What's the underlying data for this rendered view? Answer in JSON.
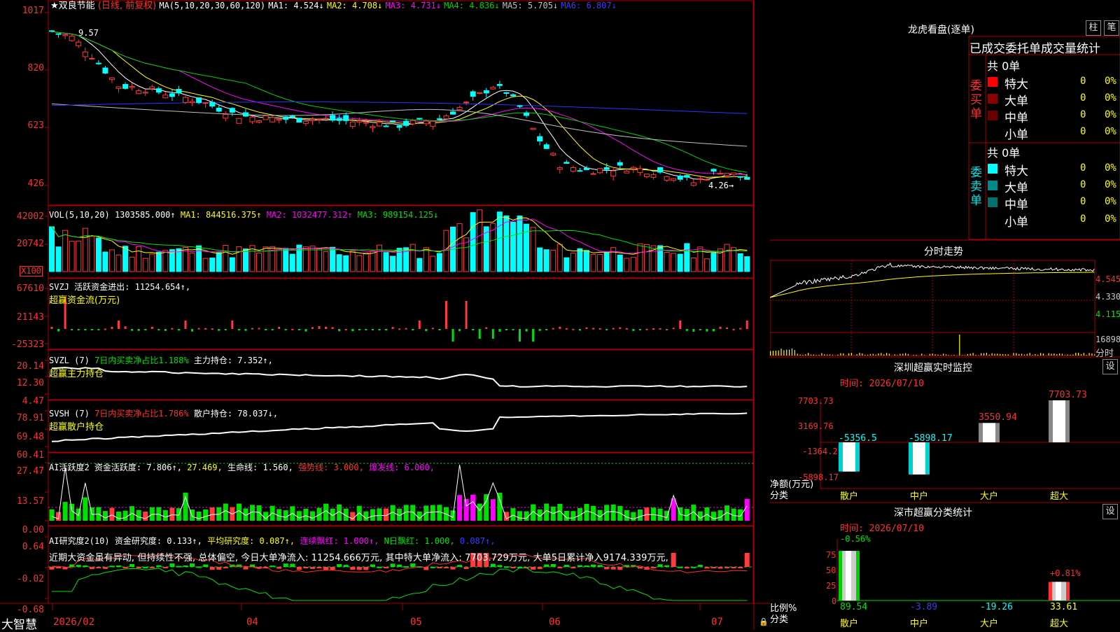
{
  "app": {
    "brand": "大智慧"
  },
  "colors": {
    "up": "#ff3b3b",
    "down": "#00ffff",
    "green": "#00e000",
    "ma1": "#ffffff",
    "ma2": "#ffff00",
    "ma3": "#ff00ff",
    "ma4": "#00d000",
    "ma5": "#c0c0c0",
    "ma6": "#3030ff",
    "grid": "#aa0000",
    "axis": "#ff3030"
  },
  "price": {
    "title": "★双良节能",
    "mode": "(日线, 前复权)",
    "ma_params": "MA(5,10,20,30,60,120)",
    "ma": [
      {
        "label": "MA1: 4.524↓"
      },
      {
        "label": "MA2: 4.708↓"
      },
      {
        "label": "MA3: 4.731↓"
      },
      {
        "label": "MA4: 4.836↓"
      },
      {
        "label": "MA5: 5.705↓"
      },
      {
        "label": "MA6: 6.807↓"
      }
    ],
    "yticks": [
      "1017",
      "820",
      "623",
      "426"
    ],
    "high_label": "9.57",
    "low_label": "4.26→"
  },
  "vol": {
    "title": "VOL(5,10,20)",
    "value": "1303585.000↑",
    "ma1": "MA1: 844516.375↑",
    "ma2": "MA2: 1032477.312↑",
    "ma3": "MA3: 989154.125↓",
    "yticks": [
      "42002",
      "20742"
    ],
    "unit": "X100"
  },
  "svzj": {
    "title": "SVZJ",
    "line": "活跃资金进出: 11254.654↑,",
    "sub": "超赢资金流(万元)",
    "yticks": [
      "67610",
      "21143",
      "-25323"
    ]
  },
  "svzl": {
    "title": "SVZL (7)",
    "l1": "7日内买卖净占比1.188%",
    "l2": "主力持仓: 7.352↑,",
    "sub": "超赢主力持仓",
    "yticks": [
      "20.14",
      "12.30",
      "4.47"
    ]
  },
  "svsh": {
    "title": "SVSH (7)",
    "l1": "7日内买卖净占比1.786%",
    "l2": "散户持仓: 78.037↓,",
    "sub": "超赢散户持仓",
    "yticks": [
      "78.91",
      "69.48",
      "60.41"
    ]
  },
  "ai1": {
    "title": "AI活跃度2",
    "l1": "资金活跃度: 7.806↑,",
    "l2": "27.469,",
    "l3": "生命线: 1.560,",
    "l4": "强势线: 3.000,",
    "l5": "爆发线: 6.000,",
    "yticks": [
      "27.47",
      "13.57",
      "0.00"
    ]
  },
  "ai2": {
    "title": "AI研究度2(10)",
    "l1": "资金研究度: 0.133↑,",
    "l2": "平均研究度: 0.087↑,",
    "l3": "连续飘红: 1.000↑,",
    "l4": "N日飘红: 1.000,",
    "l5": "0.087↑,",
    "desc": "近期大资金虽有异动, 但持续性不强, 总体偏空, 今日大单净流入: 11254.666万元, 其中特大单净流入: 7703.729万元, 大单5日累计净入9174.339万元,",
    "yticks": [
      "0.64",
      "-0.02",
      "-0.68"
    ]
  },
  "xaxis": {
    "labels": [
      "2026/02",
      "04",
      "05",
      "06",
      "07"
    ]
  },
  "right": {
    "lhb": {
      "title": "龙虎看盘(逐单)",
      "btn1": "柱",
      "btn2": "笔",
      "subtitle": "已成交委托单成交量统计",
      "buy": {
        "side": "委买单",
        "total": "共 0单",
        "rows": [
          {
            "name": "特大",
            "count": "0",
            "pct": "0%"
          },
          {
            "name": "大单",
            "count": "0",
            "pct": "0%"
          },
          {
            "name": "中单",
            "count": "0",
            "pct": "0%"
          },
          {
            "name": "小单",
            "count": "0",
            "pct": "0%"
          }
        ]
      },
      "sell": {
        "side": "委卖单",
        "total": "共 0单",
        "rows": [
          {
            "name": "特大",
            "count": "0",
            "pct": "0%"
          },
          {
            "name": "大单",
            "count": "0",
            "pct": "0%"
          },
          {
            "name": "中单",
            "count": "0",
            "pct": "0%"
          },
          {
            "name": "小单",
            "count": "0",
            "pct": "0%"
          }
        ]
      }
    },
    "intraday": {
      "title": "分时走势",
      "yticks": [
        "4.545",
        "4.330",
        "4.115"
      ],
      "vol_tick": "16898",
      "vol_label": "分时"
    },
    "monitor": {
      "title": "深圳超赢实时监控",
      "btn": "设",
      "date": "时间: 2026/07/10",
      "yticks": [
        "7703.73",
        "3169.76",
        "-1364.2",
        "-5898.17"
      ],
      "ylabel1": "净额(万元)",
      "ylabel2": "分类",
      "cats": [
        "散户",
        "中户",
        "大户",
        "超大"
      ],
      "values": [
        "-5356.5",
        "-5898.17",
        "3550.94",
        "7703.73"
      ]
    },
    "classify": {
      "title": "深市超赢分类统计",
      "btn": "设",
      "date": "时间: 2026/07/10",
      "yticks": [
        "75",
        "50",
        "25",
        "0"
      ],
      "ylabel1": "比例%",
      "ylabel2": "分类",
      "cats": [
        "散户",
        "中户",
        "大户",
        "超大"
      ],
      "values": [
        "89.54",
        "-3.89",
        "-19.26",
        "33.61"
      ],
      "top_labels": [
        "-0.56%",
        "+0.81%"
      ]
    }
  },
  "chart_data": [
    {
      "type": "candlestick",
      "title": "★双良节能",
      "ylim": [
        4.26,
        10.17
      ],
      "x_range": [
        "2026/02",
        "2026/07/10"
      ],
      "last_close": 4.52,
      "ma": {
        "MA1": 4.524,
        "MA2": 4.708,
        "MA3": 4.731,
        "MA4": 4.836,
        "MA5": 5.705,
        "MA6": 6.807
      },
      "high_marker": 9.57,
      "low_marker": 4.26
    },
    {
      "type": "bar",
      "title": "VOL(5,10,20)",
      "last": 1303585.0,
      "ylim": [
        0,
        42002
      ]
    },
    {
      "type": "bar",
      "title": "SVZJ",
      "last": 11254.654,
      "ylim": [
        -25323,
        67610
      ]
    },
    {
      "type": "line",
      "title": "SVZL (7)",
      "last": 7.352,
      "ylim": [
        4.47,
        20.14
      ]
    },
    {
      "type": "line",
      "title": "SVSH (7)",
      "last": 78.037,
      "ylim": [
        60.41,
        78.91
      ]
    },
    {
      "type": "bar",
      "title": "AI活跃度2",
      "last": 7.806,
      "ylim": [
        0,
        27.47
      ]
    },
    {
      "type": "bar",
      "title": "AI研究度2(10)",
      "last": 0.133,
      "ylim": [
        -0.68,
        0.64
      ]
    },
    {
      "type": "bar",
      "title": "深圳超赢实时监控",
      "categories": [
        "散户",
        "中户",
        "大户",
        "超大"
      ],
      "values": [
        -5356.5,
        -5898.17,
        3550.94,
        7703.73
      ],
      "ylim": [
        -5898.17,
        7703.73
      ]
    },
    {
      "type": "bar",
      "title": "深市超赢分类统计",
      "categories": [
        "散户",
        "中户",
        "大户",
        "超大"
      ],
      "values": [
        89.54,
        -3.89,
        -19.26,
        33.61
      ],
      "ylim": [
        0,
        100
      ]
    }
  ]
}
